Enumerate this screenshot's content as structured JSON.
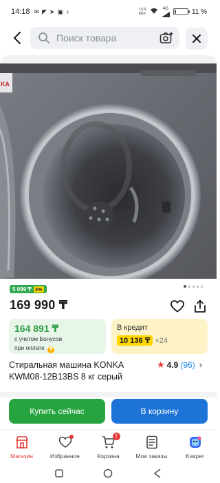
{
  "status_bar": {
    "time": "14:18",
    "net_speed": "13,9",
    "net_speed_unit": "КБ/с",
    "net_type": "4G",
    "battery_percent": 11,
    "battery_text": "11 %"
  },
  "search": {
    "placeholder": "Поиск товара"
  },
  "product_image": {
    "brand_text": "KA",
    "slide_count": 5,
    "active_slide": 0
  },
  "badge": {
    "bonus": "5 099 ₸",
    "percent": "3%"
  },
  "price": "169 990 ₸",
  "bonus_card": {
    "price": "164 891 ₸",
    "desc_line1": "с учетом Бонусов",
    "desc_line2": "при оплате",
    "coin": "₸"
  },
  "credit_card": {
    "label": "В кредит",
    "amount": "10 136 ₸",
    "months": "×24"
  },
  "product": {
    "title": "Стиральная машина KONKA KWM08-12B13BS 8 кг серый",
    "rating": "4.9",
    "reviews": "(96)"
  },
  "actions": {
    "buy_now": "Купить сейчас",
    "add_to_cart": "В корзину"
  },
  "bottom_nav": {
    "items": [
      {
        "label": "Магазин",
        "icon": "store-icon",
        "active": true
      },
      {
        "label": "Избранное",
        "icon": "heart-icon"
      },
      {
        "label": "Корзина",
        "icon": "cart-icon",
        "badge": "2"
      },
      {
        "label": "Мои заказы",
        "icon": "orders-icon"
      },
      {
        "label": "Kasper",
        "icon": "kasper-icon"
      }
    ]
  },
  "colors": {
    "accent_green": "#26a43f",
    "accent_blue": "#1e73d8",
    "accent_red": "#e53935",
    "credit_yellow": "#ffd600"
  }
}
